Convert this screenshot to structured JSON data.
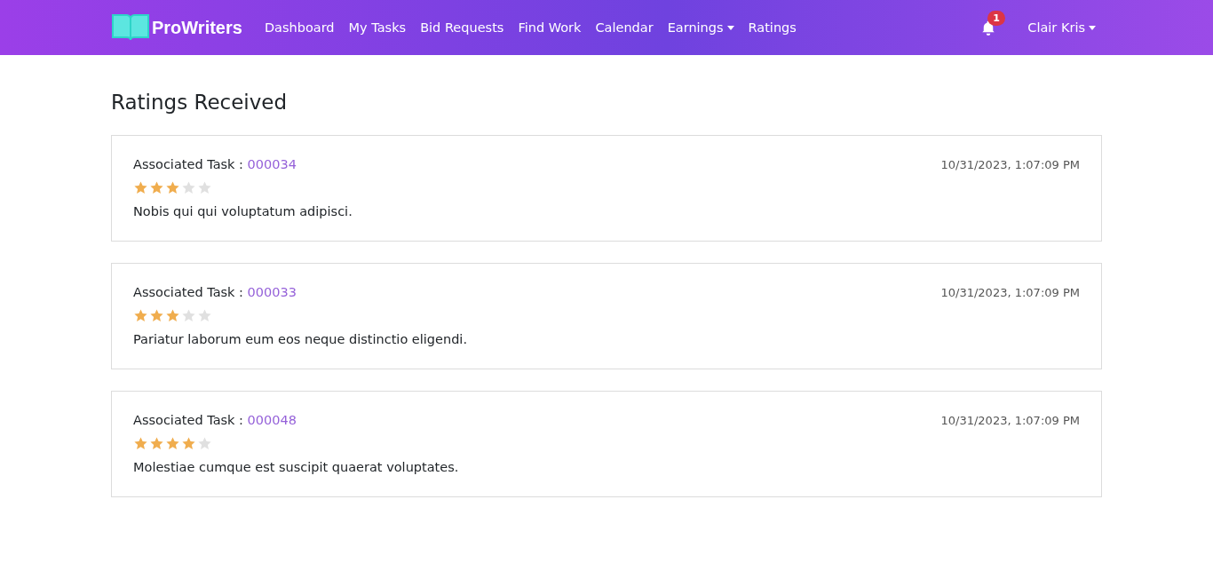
{
  "navbar": {
    "brand": "ProWriters",
    "links": [
      {
        "label": "Dashboard",
        "dropdown": false
      },
      {
        "label": "My Tasks",
        "dropdown": false
      },
      {
        "label": "Bid Requests",
        "dropdown": false
      },
      {
        "label": "Find Work",
        "dropdown": false
      },
      {
        "label": "Calendar",
        "dropdown": false
      },
      {
        "label": "Earnings",
        "dropdown": true
      },
      {
        "label": "Ratings",
        "dropdown": false
      }
    ],
    "notification_count": "1",
    "user": "Clair Kris"
  },
  "page_title": "Ratings Received",
  "ratings": [
    {
      "task_label": "Associated Task :",
      "task_id": "000034",
      "date": "10/31/2023, 1:07:09 PM",
      "stars": 3,
      "comment": "Nobis qui qui voluptatum adipisci."
    },
    {
      "task_label": "Associated Task :",
      "task_id": "000033",
      "date": "10/31/2023, 1:07:09 PM",
      "stars": 3,
      "comment": "Pariatur laborum eum eos neque distinctio eligendi."
    },
    {
      "task_label": "Associated Task :",
      "task_id": "000048",
      "date": "10/31/2023, 1:07:09 PM",
      "stars": 4,
      "comment": "Molestiae cumque est suscipit quaerat voluptates."
    }
  ]
}
